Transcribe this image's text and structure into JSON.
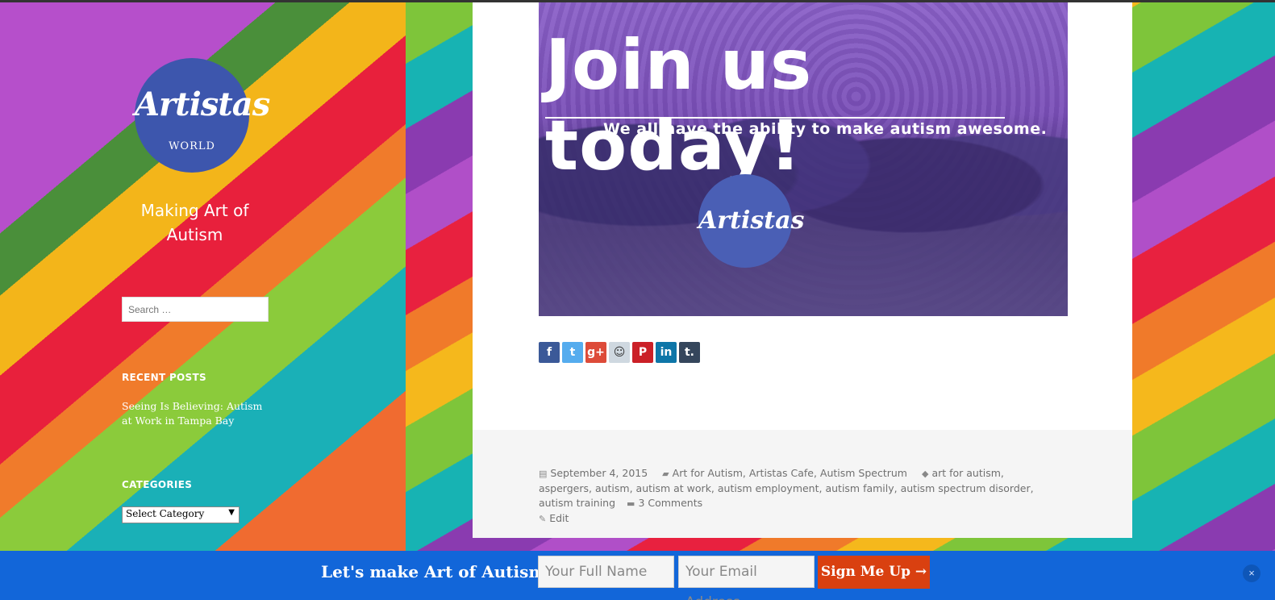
{
  "sidebar": {
    "logo_text": "Artistas",
    "logo_subtext": "WORLD",
    "tagline": "Making Art of Autism",
    "search_placeholder": "Search …",
    "recent_posts_title": "RECENT POSTS",
    "recent_posts": [
      "Seeing Is Believing: Autism at Work in Tampa Bay"
    ],
    "categories_title": "CATEGORIES",
    "category_select": "Select Category"
  },
  "hero": {
    "title": "Join us today!",
    "subtitle": "We all have the ability to make autism awesome.",
    "badge_text": "Artistas"
  },
  "share": [
    {
      "name": "facebook-icon",
      "glyph": "f",
      "color": "#3b5998"
    },
    {
      "name": "twitter-icon",
      "glyph": "t",
      "color": "#55acee"
    },
    {
      "name": "google-plus-icon",
      "glyph": "g+",
      "color": "#dd4b39"
    },
    {
      "name": "reddit-icon",
      "glyph": "☺",
      "color": "#cfd8e0"
    },
    {
      "name": "pinterest-icon",
      "glyph": "P",
      "color": "#cb2027"
    },
    {
      "name": "linkedin-icon",
      "glyph": "in",
      "color": "#0e76a8"
    },
    {
      "name": "tumblr-icon",
      "glyph": "t.",
      "color": "#35465c"
    }
  ],
  "meta": {
    "date": "September 4, 2015",
    "categories": "Art for Autism, Artistas Cafe, Autism Spectrum",
    "tags": "art for autism, aspergers, autism, autism at work, autism employment, autism family, autism spectrum disorder, autism training",
    "comments": "3 Comments",
    "edit": "Edit"
  },
  "bottom_bar": {
    "text": "Let's make Art of Autism.",
    "name_placeholder": "Your Full Name",
    "email_placeholder": "Your Email Address",
    "button": "Sign Me Up →",
    "close": "×"
  }
}
